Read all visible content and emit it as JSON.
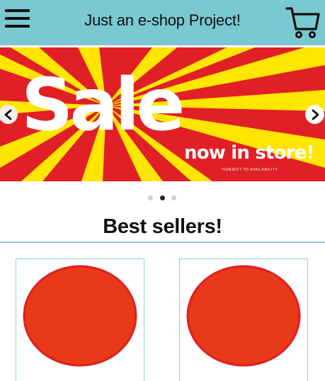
{
  "header": {
    "title": "Just an e-shop Project!",
    "menu_icon": "hamburger-menu-icon",
    "cart_icon": "shopping-cart-icon",
    "background_color": "#7ac8d0"
  },
  "carousel": {
    "slide": {
      "headline": "Sale",
      "subline": "now in store!",
      "note": "*SUBJECT TO AVAILABILITY",
      "background_color": "#e11f26",
      "ray_color": "#ffe600"
    },
    "prev_icon": "chevron-left-icon",
    "next_icon": "chevron-right-icon",
    "slide_count": 3,
    "active_index": 1
  },
  "best_sellers": {
    "title": "Best sellers!",
    "products": [
      {
        "image": "red-circle-product-image",
        "color": "#e8391a"
      },
      {
        "image": "red-circle-product-image",
        "color": "#e8391a"
      }
    ]
  }
}
